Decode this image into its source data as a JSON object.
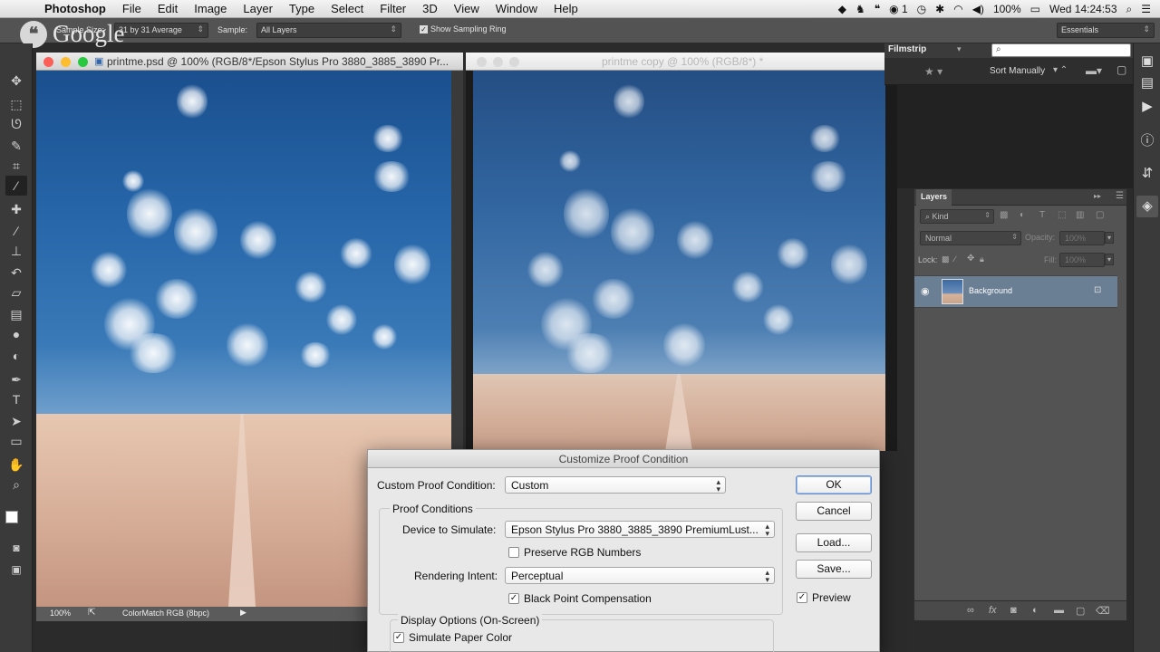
{
  "menubar": {
    "app_name": "Photoshop",
    "items": [
      "File",
      "Edit",
      "Image",
      "Layer",
      "Type",
      "Select",
      "Filter",
      "3D",
      "View",
      "Window",
      "Help"
    ],
    "notification_count": "1",
    "battery": "100%",
    "clock": "Wed 14:24:53"
  },
  "optionsbar": {
    "sample_size_label": "Sample Size:",
    "sample_size_value": "31 by 31 Average",
    "sample_label": "Sample:",
    "sample_value": "All Layers",
    "show_ring_label": "Show Sampling Ring",
    "workspace": "Essentials",
    "overlay_logo": "Google"
  },
  "doc1": {
    "title": "printme.psd @ 100% (RGB/8*/Epson Stylus Pro 3880_3885_3890 Pr...",
    "zoom": "100%",
    "profile": "ColorMatch RGB (8bpc)"
  },
  "doc2": {
    "title": "printme copy @ 100% (RGB/8*) *"
  },
  "filmstrip": {
    "title": "Filmstrip",
    "sort": "Sort Manually"
  },
  "layers_panel": {
    "tab": "Layers",
    "kind_filter": "Kind",
    "blend_mode": "Normal",
    "opacity_label": "Opacity:",
    "opacity_value": "100%",
    "lock_label": "Lock:",
    "fill_label": "Fill:",
    "fill_value": "100%",
    "layers": [
      {
        "name": "Background"
      }
    ]
  },
  "dialog": {
    "title": "Customize Proof Condition",
    "custom_label": "Custom Proof Condition:",
    "custom_value": "Custom",
    "proof_group": "Proof Conditions",
    "device_label": "Device to Simulate:",
    "device_value": "Epson Stylus Pro 3880_3885_3890 PremiumLust...",
    "preserve_rgb": "Preserve RGB Numbers",
    "intent_label": "Rendering Intent:",
    "intent_value": "Perceptual",
    "black_point": "Black Point Compensation",
    "display_group": "Display Options (On-Screen)",
    "simulate_paper": "Simulate Paper Color",
    "buttons": {
      "ok": "OK",
      "cancel": "Cancel",
      "load": "Load...",
      "save": "Save..."
    },
    "preview": "Preview",
    "checks": {
      "preserve_rgb": false,
      "black_point": true,
      "simulate_paper": true,
      "preview": true
    }
  },
  "icons": {
    "apple": "",
    "check": "✓",
    "caret_up_down": "▲▼"
  }
}
